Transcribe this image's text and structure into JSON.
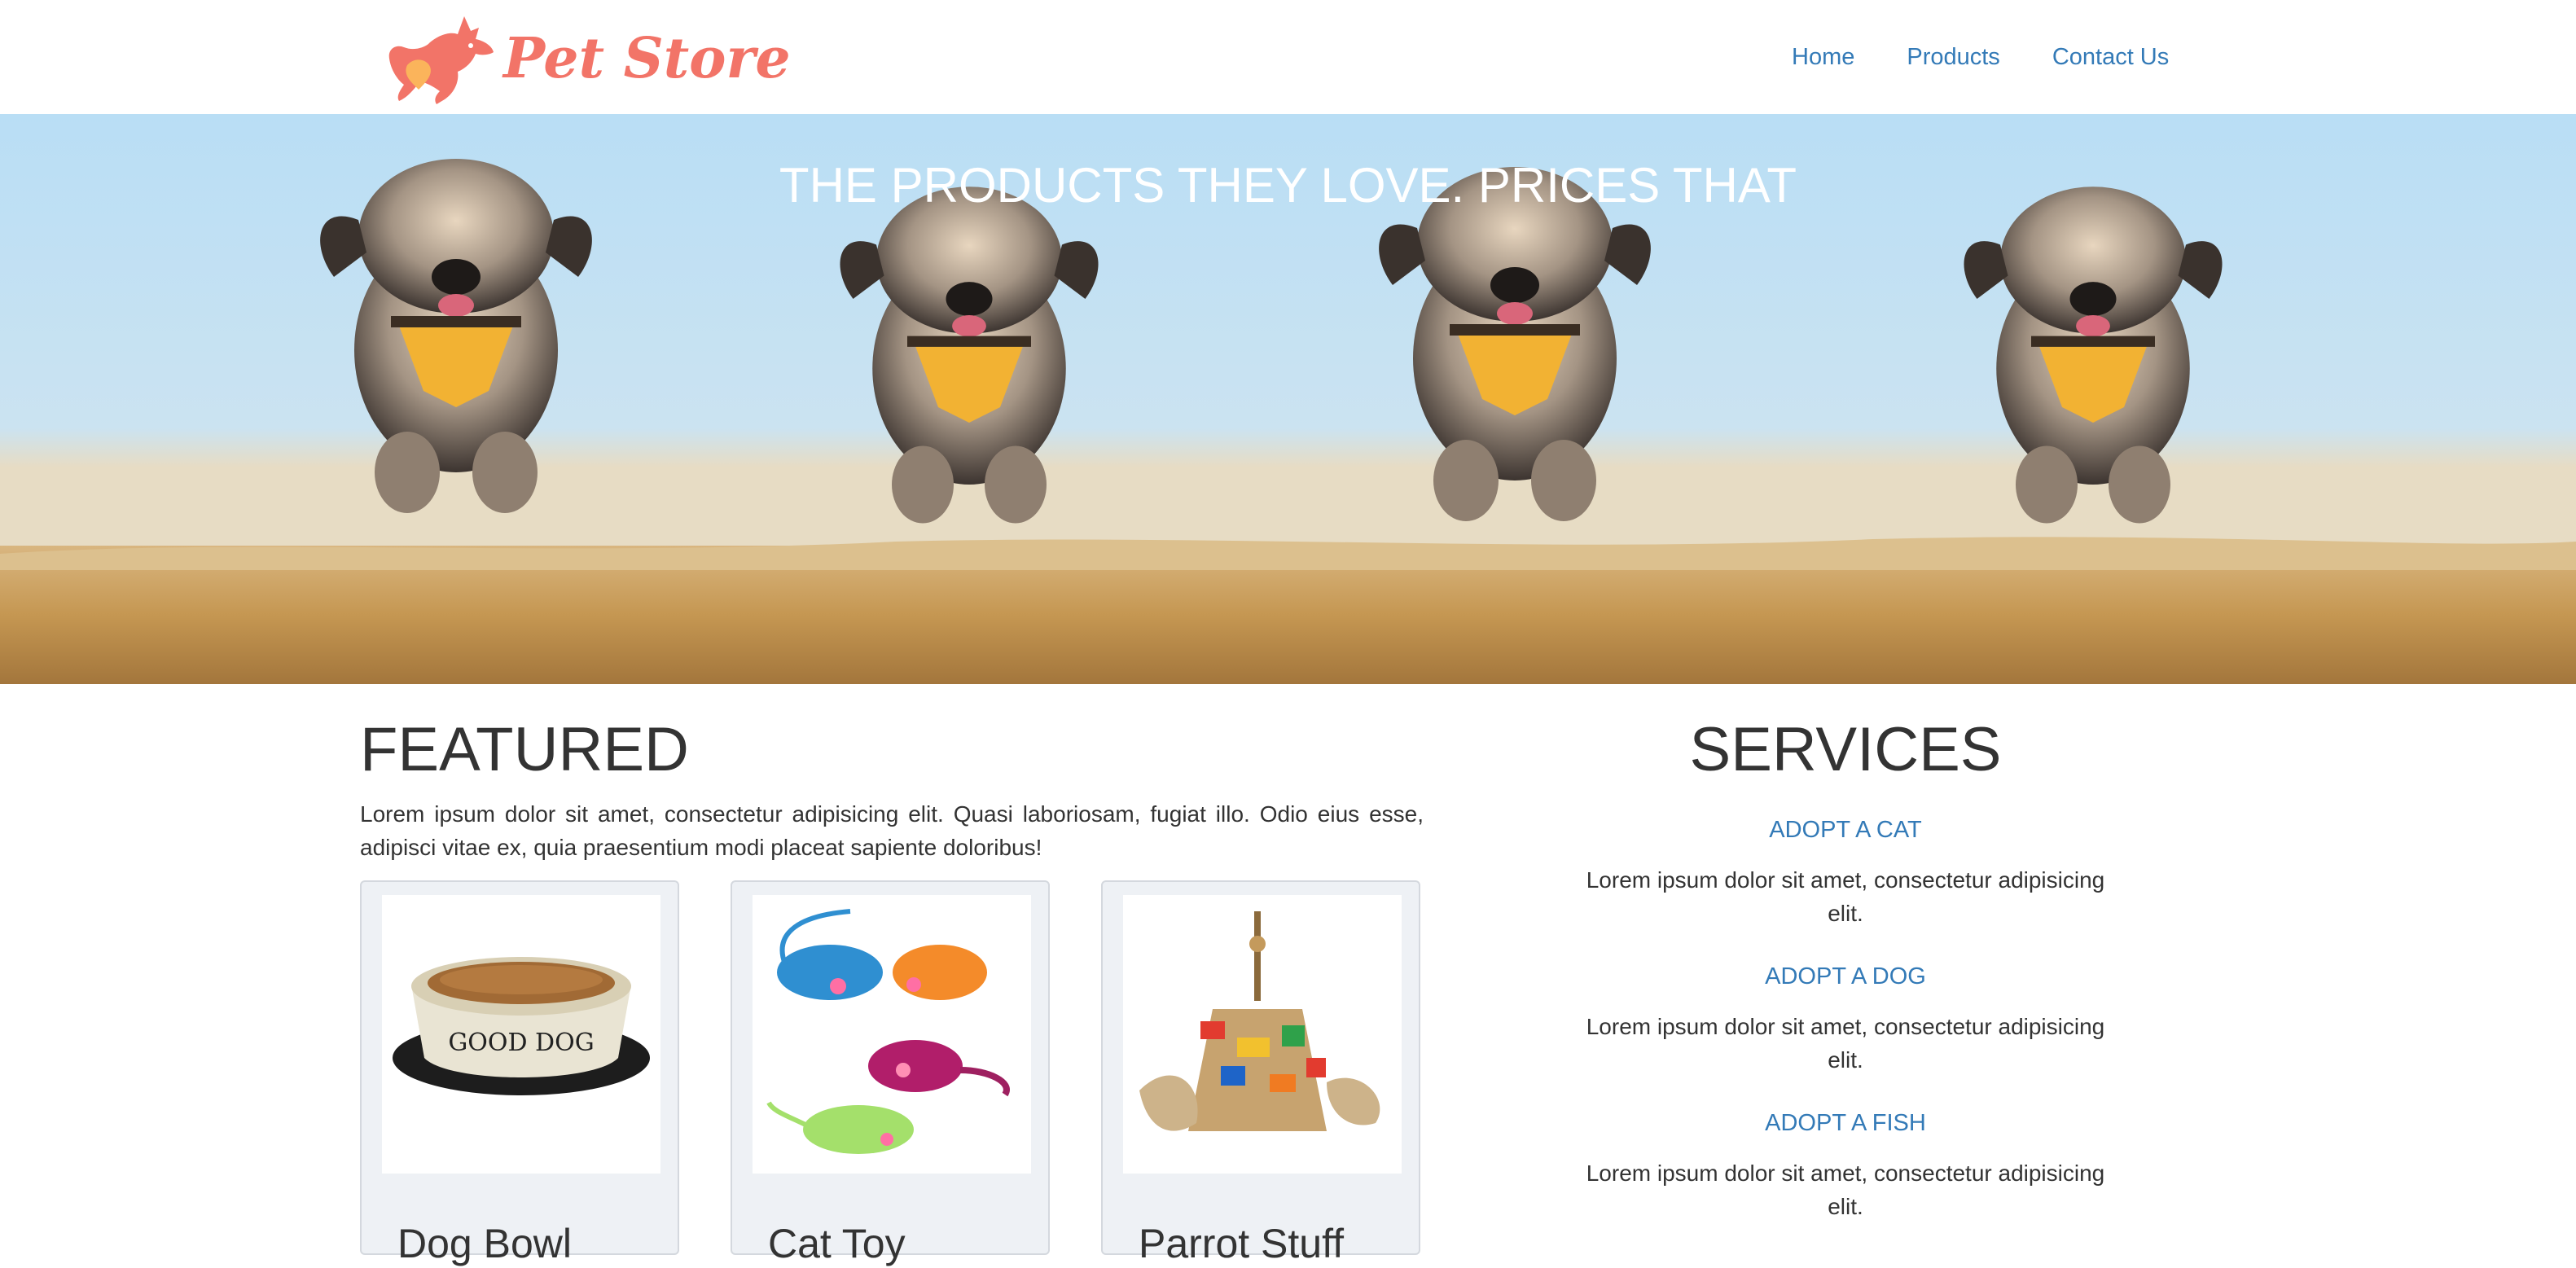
{
  "colors": {
    "link": "#337ab7",
    "text": "#333333",
    "logo": "#f27468",
    "hero_text": "#ffffff",
    "card_bg": "#eef1f5"
  },
  "header": {
    "brand": "Pet Store",
    "nav": [
      {
        "label": "Home"
      },
      {
        "label": "Products"
      },
      {
        "label": "Contact Us"
      }
    ]
  },
  "hero": {
    "title": "THE PRODUCTS THEY LOVE. PRICES THAT"
  },
  "featured": {
    "title": "FEATURED",
    "description": "Lorem ipsum dolor sit amet, consectetur adipisicing elit. Quasi laboriosam, fugiat illo. Odio eius esse, adipisci vitae ex, quia praesentium modi placeat sapiente doloribus!",
    "products": [
      {
        "name": "Dog Bowl",
        "image_text": "GOOD DOG"
      },
      {
        "name": "Cat Toy"
      },
      {
        "name": "Parrot Stuff"
      }
    ]
  },
  "services": {
    "title": "SERVICES",
    "items": [
      {
        "label": "ADOPT A CAT",
        "text": "Lorem ipsum dolor sit amet, consectetur adipisicing elit."
      },
      {
        "label": "ADOPT A DOG",
        "text": "Lorem ipsum dolor sit amet, consectetur adipisicing elit."
      },
      {
        "label": "ADOPT A FISH",
        "text": "Lorem ipsum dolor sit amet, consectetur adipisicing elit."
      }
    ]
  }
}
